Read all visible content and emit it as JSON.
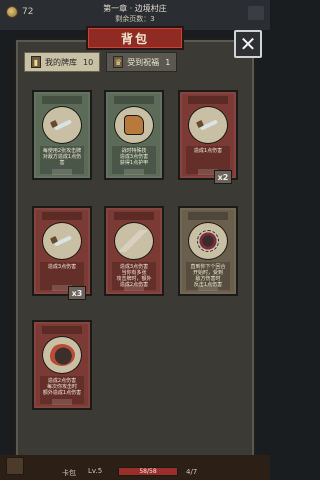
{
  "top": {
    "coins": "72",
    "chapter": "第一章 · 边境村庄",
    "remaining": "剩余页数：3"
  },
  "panel": {
    "title": "背包",
    "tabs": [
      {
        "label": "我的牌库",
        "count": "10",
        "icon": "cards-icon",
        "active": true
      },
      {
        "label": "受到祝福",
        "count": "1",
        "icon": "blessing-icon",
        "active": false
      }
    ]
  },
  "cards": [
    {
      "name": "",
      "color": "#5b6b58",
      "desc": "每使用2张攻击牌\n对敌方造成1点伤害",
      "cost": "",
      "icon": "sword-icon",
      "badge": ""
    },
    {
      "name": "",
      "color": "#5b6b58",
      "desc": "战时特殊技\n造成3点伤害\n获得1点护甲",
      "cost": "",
      "icon": "horse-icon",
      "badge": ""
    },
    {
      "name": "",
      "color": "#7b3a33",
      "desc": "造成1点伤害",
      "cost": "",
      "icon": "sword-icon",
      "badge": "x2"
    },
    {
      "name": "",
      "color": "#7b3a33",
      "desc": "造成3点伤害",
      "cost": "",
      "icon": "sword-icon",
      "badge": "x3"
    },
    {
      "name": "",
      "color": "#7b3a33",
      "desc": "造成3点伤害\n当你有多张\n攻击牌时，额外\n造成2点伤害",
      "cost": "",
      "icon": "spikes-icon",
      "badge": ""
    },
    {
      "name": "",
      "color": "#6a5f4c",
      "desc": "直到你下个回合\n开始时，受到\n敌方伤害时\n反击1点伤害",
      "cost": "",
      "icon": "spider-icon",
      "badge": ""
    },
    {
      "name": "",
      "color": "#7b3a33",
      "desc": "造成2点伤害\n每次你攻击时\n额外造成1点伤害",
      "cost": "",
      "icon": "claw-icon",
      "badge": ""
    }
  ],
  "bottom": {
    "deck_label": "卡包",
    "level": "Lv.5",
    "hp": "58/58",
    "energy": "4/7"
  },
  "colors": {
    "panel_bg": "#3b3a35",
    "title_red": "#8f2b23",
    "accent": "#c9c1a6"
  }
}
